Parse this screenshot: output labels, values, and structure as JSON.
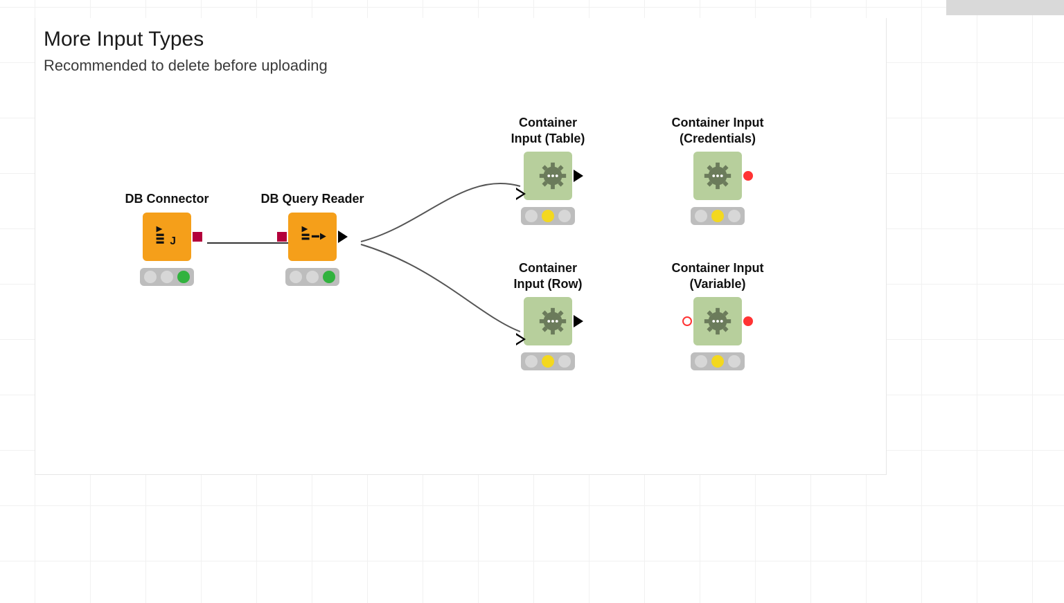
{
  "panel": {
    "title": "More Input Types",
    "subtitle": "Recommended to delete before uploading"
  },
  "nodes": {
    "db_connector": {
      "label": "DB Connector",
      "status": "green"
    },
    "db_query_reader": {
      "label": "DB Query Reader",
      "status": "green"
    },
    "container_table": {
      "label": "Container\nInput (Table)",
      "status": "yellow"
    },
    "container_row": {
      "label": "Container\nInput (Row)",
      "status": "yellow"
    },
    "container_credentials": {
      "label": "Container Input\n(Credentials)",
      "status": "yellow"
    },
    "container_variable": {
      "label": "Container Input\n(Variable)",
      "status": "yellow"
    }
  }
}
